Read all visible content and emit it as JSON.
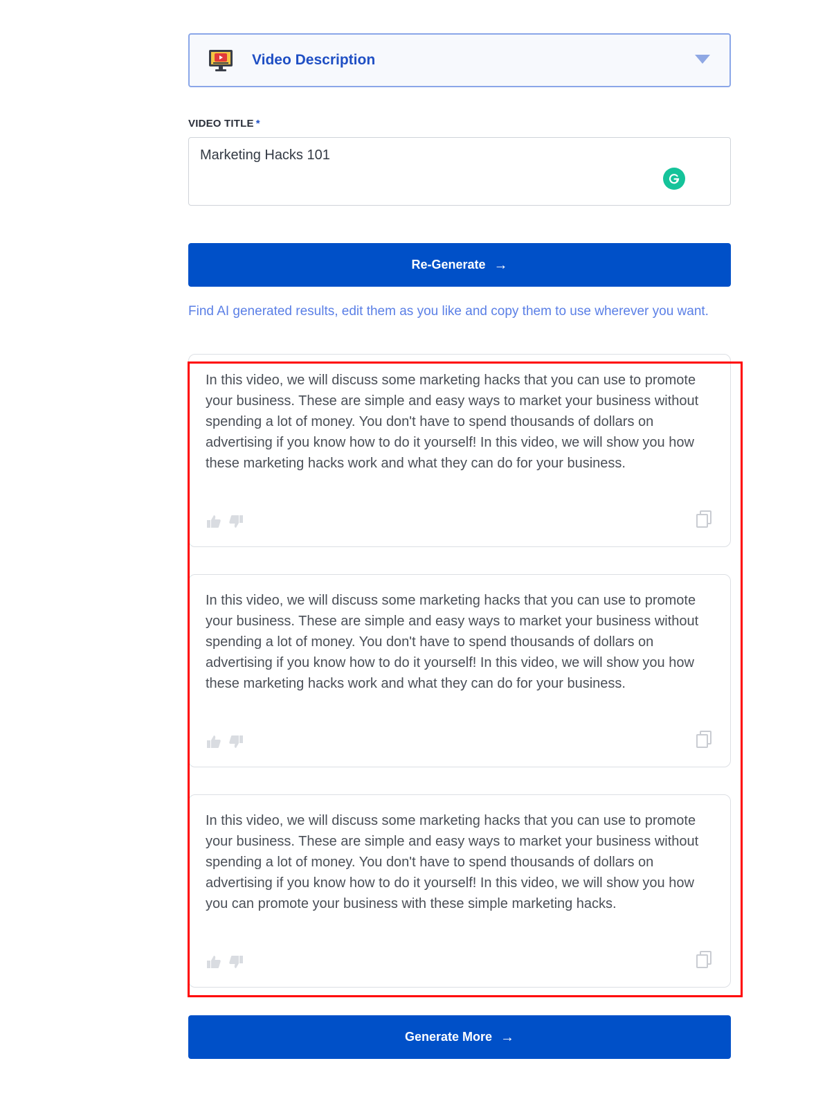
{
  "template_select": {
    "label": "Video Description",
    "icon": "monitor-video-icon"
  },
  "video_title": {
    "label": "VIDEO TITLE",
    "required_marker": "*",
    "value": "Marketing Hacks 101"
  },
  "regenerate_button": {
    "label": "Re-Generate",
    "arrow": "→"
  },
  "hint": "Find AI generated results, edit them as you like and copy them to use wherever you want.",
  "results": [
    {
      "text": "In this video, we will discuss some marketing hacks that you can use to promote your business. These are simple and easy ways to market your business without spending a lot of money. You don't have to spend thousands of dollars on advertising if you know how to do it yourself! In this video, we will show you how these marketing hacks work and what they can do for your business."
    },
    {
      "text": "In this video, we will discuss some marketing hacks that you can use to promote your business. These are simple and easy ways to market your business without spending a lot of money. You don't have to spend thousands of dollars on advertising if you know how to do it yourself! In this video, we will show you how these marketing hacks work and what they can do for your business."
    },
    {
      "text": "In this video, we will discuss some marketing hacks that you can use to promote your business. These are simple and easy ways to market your business without spending a lot of money. You don't have to spend thousands of dollars on advertising if you know how to do it yourself! In this video, we will show you how you can promote your business with these simple marketing hacks."
    }
  ],
  "generate_more_button": {
    "label": "Generate More",
    "arrow": "→"
  },
  "colors": {
    "primary": "#0050c8",
    "hint": "#5a7fe6",
    "highlight": "#ff0000",
    "grammarly": "#15c39a"
  }
}
